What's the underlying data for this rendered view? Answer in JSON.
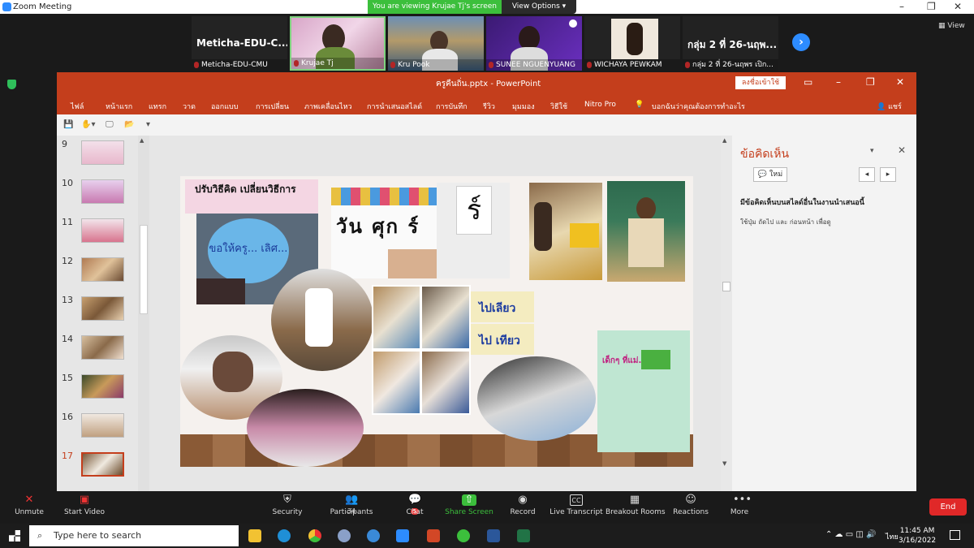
{
  "zoom": {
    "window_title": "Zoom Meeting",
    "viewing_banner": "You are viewing Krujae Tj's screen",
    "view_options": "View Options",
    "view_button": "View",
    "next_glyph": "›",
    "gallery": [
      {
        "big": "Meticha-EDU-C...",
        "name": "Meticha-EDU-CMU"
      },
      {
        "big": "",
        "name": "Krujae Tj"
      },
      {
        "big": "",
        "name": "Kru Pook"
      },
      {
        "big": "",
        "name": "SUNEE NGUENYUANG"
      },
      {
        "big": "",
        "name": "WICHAYA PEWKAM"
      },
      {
        "big": "กลุ่ม 2 ที่ 26-นฤพ...",
        "name": "กลุ่ม 2 ที่ 26-นฤพร เปิก..."
      }
    ],
    "controls": [
      {
        "label": "Unmute",
        "icon": "mic-muted-icon",
        "glyph": "🎤"
      },
      {
        "label": "Start Video",
        "icon": "camera-off-icon",
        "glyph": "▣"
      },
      {
        "label": "Security",
        "icon": "shield-icon",
        "glyph": "⛨"
      },
      {
        "label": "Participants",
        "icon": "participants-icon",
        "glyph": "👥",
        "count": "34"
      },
      {
        "label": "Chat",
        "icon": "chat-icon",
        "glyph": "💬",
        "badge": "5"
      },
      {
        "label": "Share Screen",
        "icon": "share-screen-icon",
        "glyph": "⇧"
      },
      {
        "label": "Record",
        "icon": "record-icon",
        "glyph": "◉"
      },
      {
        "label": "Live Transcript",
        "icon": "cc-icon",
        "glyph": "CC"
      },
      {
        "label": "Breakout Rooms",
        "icon": "breakout-icon",
        "glyph": "▦"
      },
      {
        "label": "Reactions",
        "icon": "reactions-icon",
        "glyph": "☺"
      },
      {
        "label": "More",
        "icon": "more-icon",
        "glyph": "•••"
      }
    ],
    "end_label": "End",
    "share_color": "#3cbf3c"
  },
  "ppt": {
    "doc_title": "ครูคืนถิ่น.pptx  -  PowerPoint",
    "signin": "ลงชื่อเข้าใช้",
    "ribbon": [
      "ไฟล์",
      "หน้าแรก",
      "แทรก",
      "วาด",
      "ออกแบบ",
      "การเปลี่ยน",
      "ภาพเคลื่อนไหว",
      "การนำเสนอสไลด์",
      "การบันทึก",
      "รีวิว",
      "มุมมอง",
      "วิธีใช้",
      "Nitro Pro",
      "บอกฉันว่าคุณต้องการทำอะไร"
    ],
    "share": "แชร์",
    "thumbnails": [
      "9",
      "10",
      "11",
      "12",
      "13",
      "14",
      "15",
      "16",
      "17"
    ],
    "selected_thumbnail": "17",
    "slide": {
      "title": "ปรับวิธีคิด เปลี่ยนวิธีการ",
      "balloon": "ขอให้ครู... เลิศ...",
      "card1": "วัน ศุก ร์",
      "card2": "ร์",
      "sticker1": "ไปเลียว",
      "sticker2": "ไป เทียว",
      "poster": "เด็กๆ ที่แม่..."
    },
    "comments": {
      "title": "ข้อคิดเห็น",
      "new": "ใหม่",
      "subtitle": "มีข้อคิดเห็นบนสไลด์อื่นในงานนำเสนอนี้",
      "hint": "ใช้ปุ่ม ถัดไป และ ก่อนหน้า เพื่อดู"
    },
    "accent": "#c43e1c"
  },
  "taskbar": {
    "search_placeholder": "Type here to search",
    "time": "11:45 AM",
    "date": "3/16/2022",
    "lang": "ไทย"
  }
}
